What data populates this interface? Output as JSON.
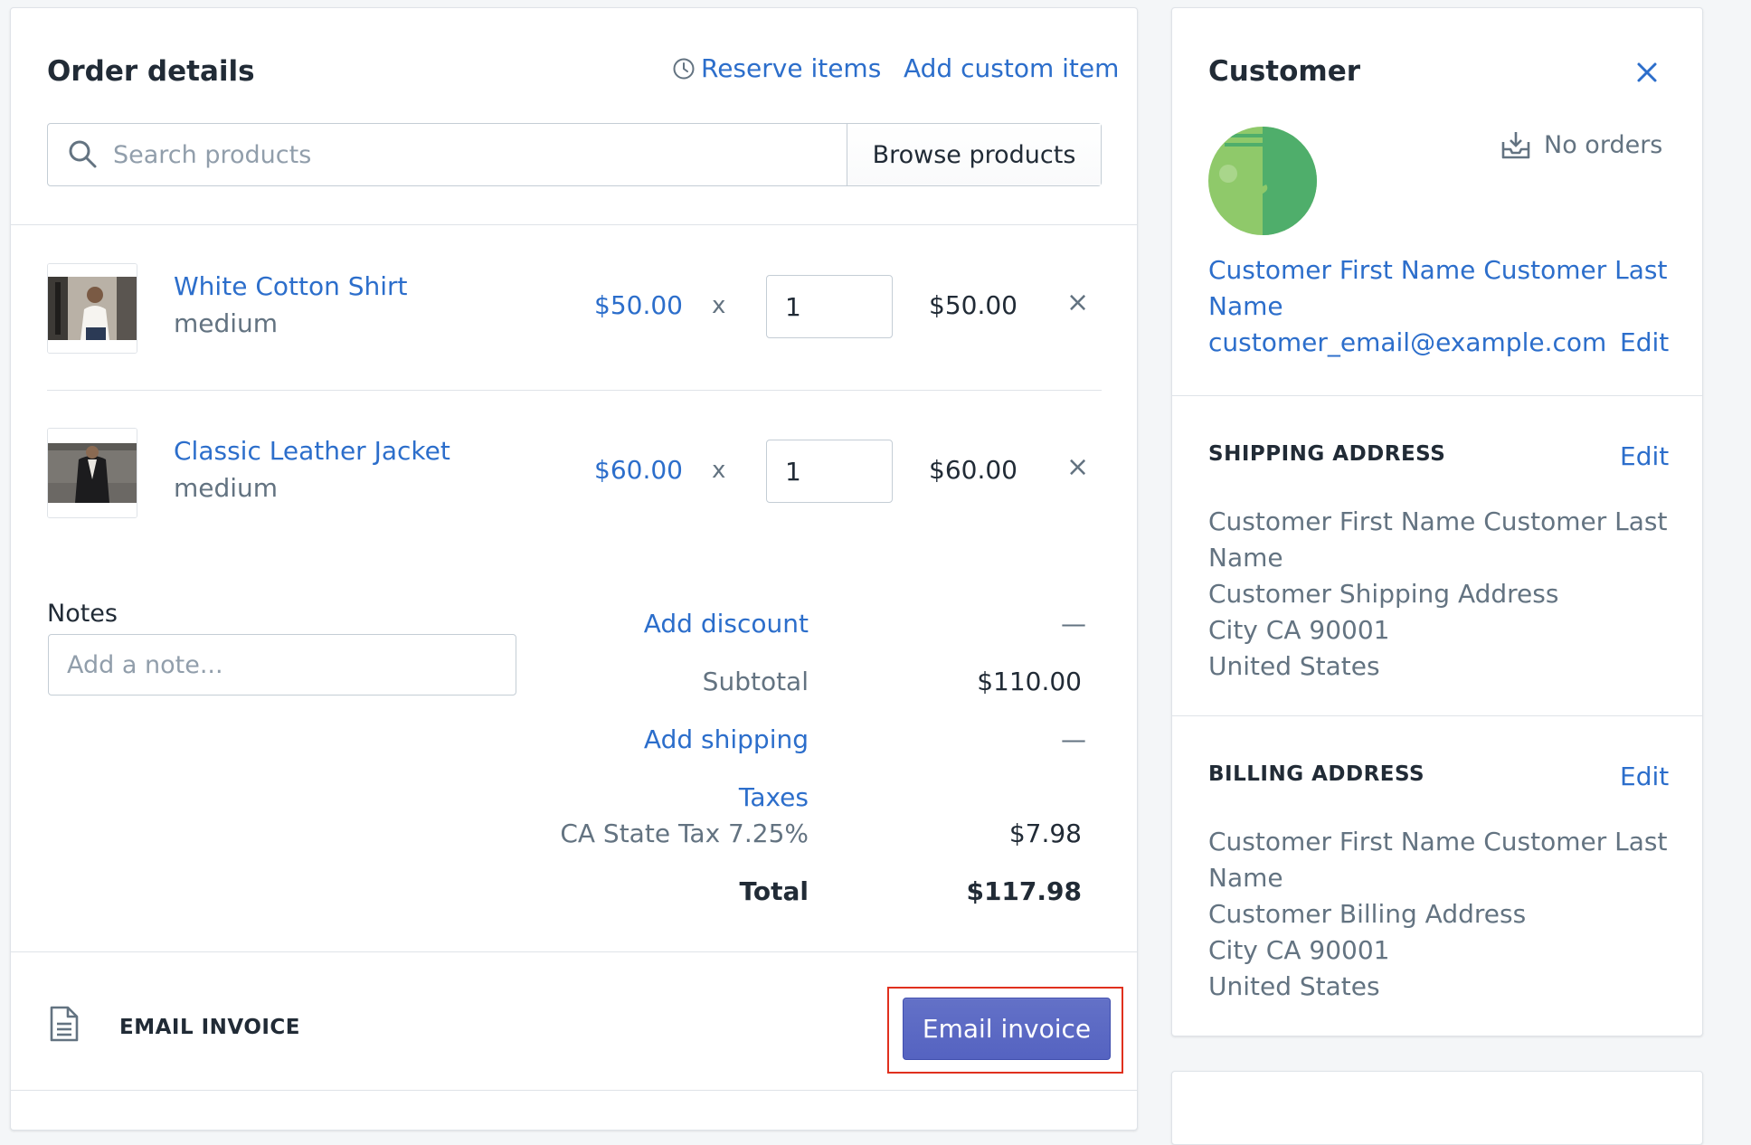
{
  "order": {
    "title": "Order details",
    "reserve_items": "Reserve items",
    "add_custom_item": "Add custom item",
    "search_placeholder": "Search products",
    "browse_products": "Browse products",
    "items": [
      {
        "name": "White Cotton Shirt",
        "variant": "medium",
        "price": "$50.00",
        "times": "x",
        "qty": "1",
        "total": "$50.00"
      },
      {
        "name": "Classic Leather Jacket",
        "variant": "medium",
        "price": "$60.00",
        "times": "x",
        "qty": "1",
        "total": "$60.00"
      }
    ],
    "notes_label": "Notes",
    "notes_placeholder": "Add a note...",
    "summary": {
      "add_discount": "Add discount",
      "discount_value": "—",
      "subtotal_label": "Subtotal",
      "subtotal_value": "$110.00",
      "add_shipping": "Add shipping",
      "shipping_value": "—",
      "taxes_label": "Taxes",
      "tax_line_label": "CA State Tax 7.25%",
      "tax_line_value": "$7.98",
      "total_label": "Total",
      "total_value": "$117.98"
    },
    "email_invoice_label": "EMAIL INVOICE",
    "email_invoice_button": "Email invoice"
  },
  "customer": {
    "title": "Customer",
    "orders_count": "No orders",
    "name_line1": "Customer First Name Customer Last",
    "name_line2": "Name",
    "email": "customer_email@example.com",
    "edit": "Edit",
    "shipping": {
      "heading": "SHIPPING ADDRESS",
      "edit": "Edit",
      "lines": [
        "Customer First Name Customer Last",
        "Name",
        "Customer Shipping Address",
        "City CA 90001",
        "United States"
      ]
    },
    "billing": {
      "heading": "BILLING ADDRESS",
      "edit": "Edit",
      "lines": [
        "Customer First Name Customer Last",
        "Name",
        "Customer Billing Address",
        "City CA 90001",
        "United States"
      ]
    }
  },
  "colors": {
    "link": "#2c6ecb",
    "primary_button": "#5c6ac4",
    "avatar_light": "#8fc96a",
    "avatar_dark": "#4fae6b",
    "highlight": "#e0301e"
  }
}
